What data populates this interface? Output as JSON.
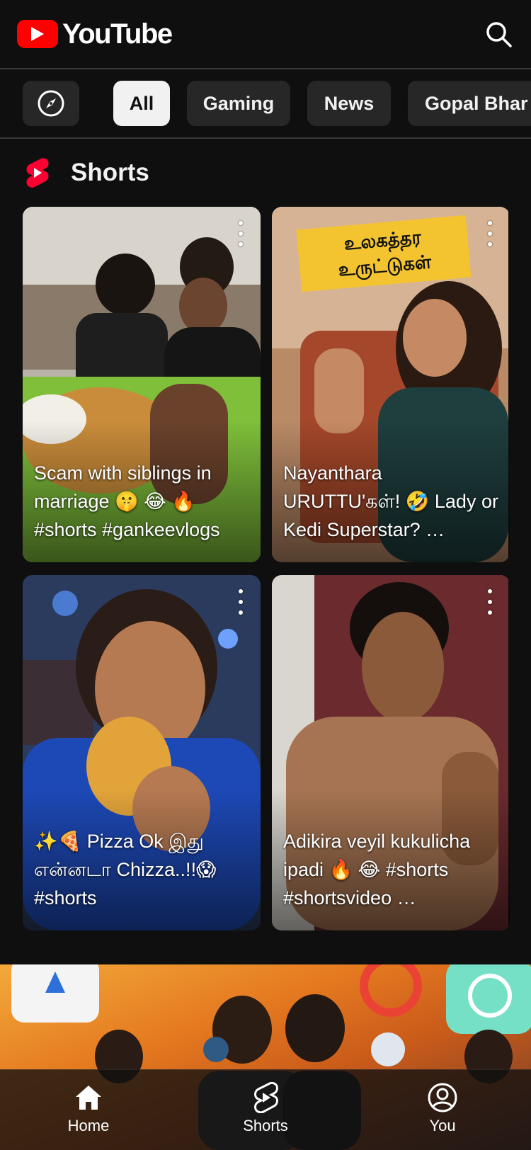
{
  "app": {
    "logo_text": "YouTube",
    "brand_red": "#ff0000",
    "background": "#0f0f0f"
  },
  "header": {
    "search_icon": "search-icon"
  },
  "chips": {
    "explore_icon": "compass-icon",
    "items": [
      {
        "label": "All",
        "active": true
      },
      {
        "label": "Gaming",
        "active": false
      },
      {
        "label": "News",
        "active": false
      },
      {
        "label": "Gopal Bhar",
        "active": false
      }
    ]
  },
  "shorts": {
    "section_title": "Shorts",
    "section_icon": "shorts-logo-icon",
    "cards": [
      {
        "title": "Scam with siblings in marriage 🤫 😂 🔥 #shorts #gankeevlogs",
        "menu_icon": "more-vert-icon"
      },
      {
        "title": "Nayanthara URUTTU'கள்! 🤣  Lady or Kedi Superstar? …",
        "thumb_caption": "உலகத்தர உருட்டுகள்",
        "menu_icon": "more-vert-icon"
      },
      {
        "title": "✨🍕 Pizza Ok இது என்னடா Chizza..!!😱 #shorts",
        "menu_icon": "more-vert-icon"
      },
      {
        "title": "Adikira veyil kukulicha ipadi 🔥 😂  #shorts #shortsvideo …",
        "menu_icon": "more-vert-icon"
      }
    ]
  },
  "bottom_nav": {
    "items": [
      {
        "label": "Home",
        "icon": "home-icon"
      },
      {
        "label": "Shorts",
        "icon": "shorts-icon"
      },
      {
        "label": "You",
        "icon": "account-icon"
      }
    ]
  }
}
